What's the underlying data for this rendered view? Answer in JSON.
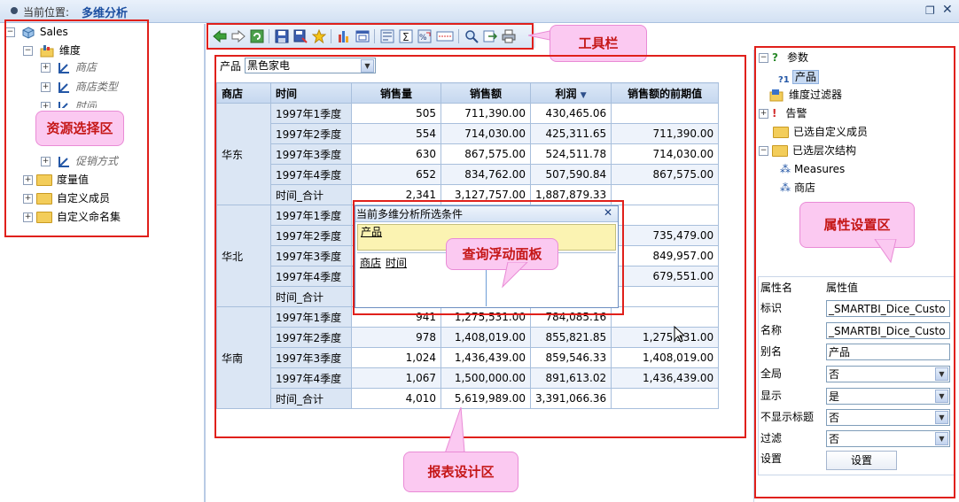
{
  "header": {
    "crumb_label": "当前位置:",
    "crumb_page": "多维分析",
    "restore_icon": "❐",
    "close_icon": "✕"
  },
  "tree": {
    "root": "Sales",
    "dimension": "维度",
    "dim_items": [
      "商店",
      "商店类型",
      "时间",
      "促销方式"
    ],
    "measures": "度量值",
    "custom_members": "自定义成员",
    "custom_sets": "自定义命名集"
  },
  "filter": {
    "label": "产品",
    "value": "黑色家电"
  },
  "grid": {
    "headers": [
      "商店",
      "时间",
      "销售量",
      "销售额",
      "利润",
      "销售额的前期值"
    ],
    "sort_icon": "▼",
    "groups": [
      {
        "region": "华东",
        "rows": [
          {
            "time": "1997年1季度",
            "qty": "505",
            "sales": "711,390.00",
            "profit": "430,465.06",
            "prev": ""
          },
          {
            "time": "1997年2季度",
            "qty": "554",
            "sales": "714,030.00",
            "profit": "425,311.65",
            "prev": "711,390.00"
          },
          {
            "time": "1997年3季度",
            "qty": "630",
            "sales": "867,575.00",
            "profit": "524,511.78",
            "prev": "714,030.00"
          },
          {
            "time": "1997年4季度",
            "qty": "652",
            "sales": "834,762.00",
            "profit": "507,590.84",
            "prev": "867,575.00"
          },
          {
            "time": "时间_合计",
            "qty": "2,341",
            "sales": "3,127,757.00",
            "profit": "1,887,879.33",
            "prev": ""
          }
        ]
      },
      {
        "region": "华北",
        "rows": [
          {
            "time": "1997年1季度",
            "qty": "",
            "sales": "",
            "profit": "",
            "prev": ""
          },
          {
            "time": "1997年2季度",
            "qty": "",
            "sales": "",
            "profit": "",
            "prev": "735,479.00"
          },
          {
            "time": "1997年3季度",
            "qty": "",
            "sales": "",
            "profit": "",
            "prev": "849,957.00"
          },
          {
            "time": "1997年4季度",
            "qty": "",
            "sales": "",
            "profit": "",
            "prev": "679,551.00"
          },
          {
            "time": "时间_合计",
            "qty": "",
            "sales": "",
            "profit": "",
            "prev": ""
          }
        ]
      },
      {
        "region": "华南",
        "rows": [
          {
            "time": "1997年1季度",
            "qty": "941",
            "sales": "1,275,531.00",
            "profit": "784,085.16",
            "prev": ""
          },
          {
            "time": "1997年2季度",
            "qty": "978",
            "sales": "1,408,019.00",
            "profit": "855,821.85",
            "prev": "1,275,531.00"
          },
          {
            "time": "1997年3季度",
            "qty": "1,024",
            "sales": "1,436,439.00",
            "profit": "859,546.33",
            "prev": "1,408,019.00"
          },
          {
            "time": "1997年4季度",
            "qty": "1,067",
            "sales": "1,500,000.00",
            "profit": "891,613.02",
            "prev": "1,436,439.00"
          },
          {
            "time": "时间_合计",
            "qty": "4,010",
            "sales": "5,619,989.00",
            "profit": "3,391,066.36",
            "prev": ""
          }
        ]
      }
    ]
  },
  "floating_panel": {
    "title": "当前多维分析所选条件",
    "close": "✕",
    "filter_item": "产品",
    "row_items": [
      "商店",
      "时间"
    ]
  },
  "right_tree": {
    "params": "参数",
    "param_item": "产品",
    "dim_filter": "维度过滤器",
    "alerts": "告警",
    "selected_custom": "已选自定义成员",
    "selected_hier": "已选层次结构",
    "measures": "Measures",
    "store": "商店"
  },
  "props": {
    "header_name": "属性名",
    "header_value": "属性值",
    "rows": [
      {
        "name": "标识",
        "value": "_SMARTBI_Dice_Custo",
        "kind": "input"
      },
      {
        "name": "名称",
        "value": "_SMARTBI_Dice_Custo",
        "kind": "input"
      },
      {
        "name": "别名",
        "value": "产品",
        "kind": "input"
      },
      {
        "name": "全局",
        "value": "否",
        "kind": "select"
      },
      {
        "name": "显示",
        "value": "是",
        "kind": "select"
      },
      {
        "name": "不显示标题",
        "value": "否",
        "kind": "select"
      },
      {
        "name": "过滤",
        "value": "否",
        "kind": "select"
      }
    ],
    "settings_label": "设置",
    "settings_button": "设置"
  },
  "callouts": {
    "toolbar": "工具栏",
    "resource": "资源选择区",
    "float": "查询浮动面板",
    "property": "属性设置区",
    "designer": "报表设计区"
  },
  "colors": {
    "callout_bg": "#fbc9f1",
    "callout_text": "#c51717",
    "highlight_box": "#e0201b"
  }
}
